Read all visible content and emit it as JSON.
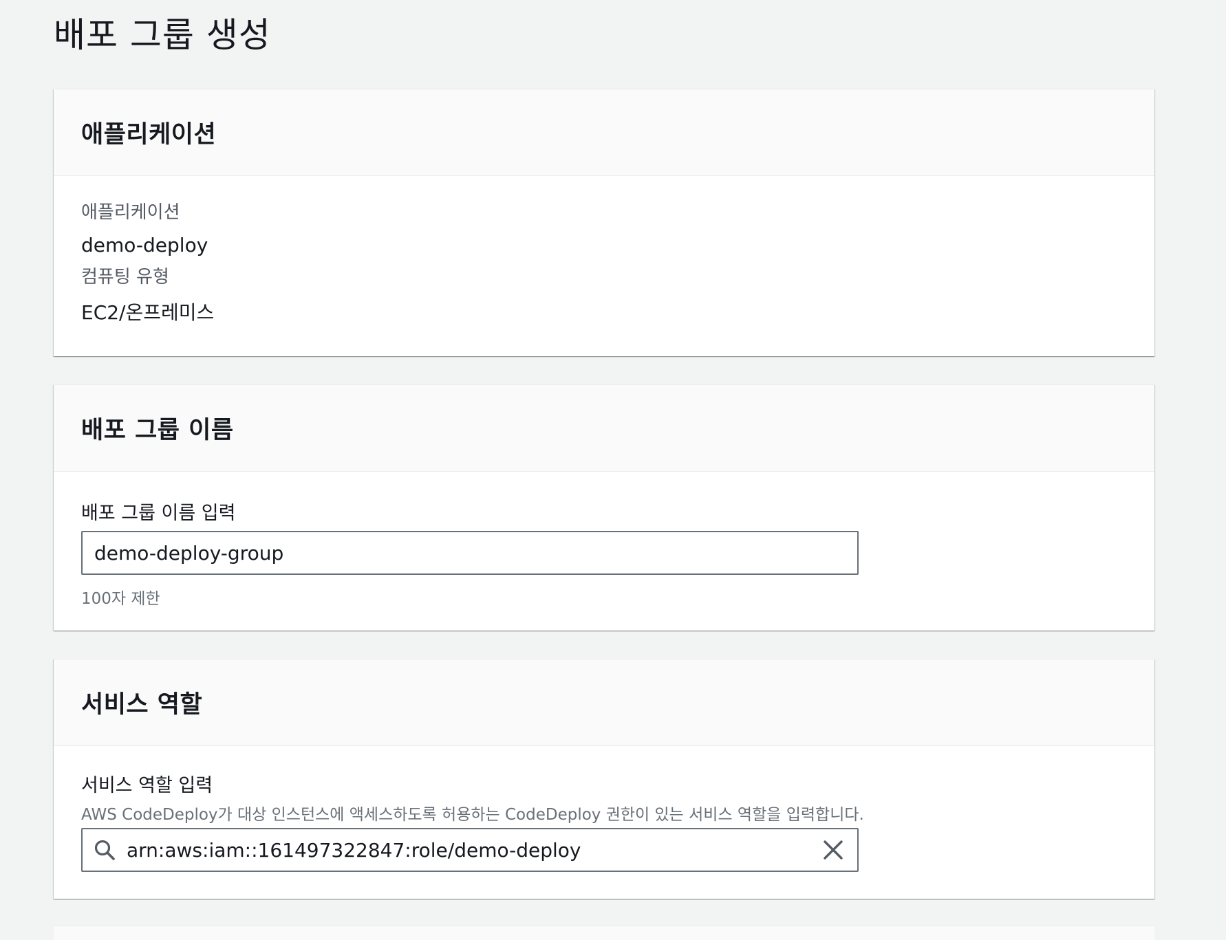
{
  "page": {
    "title": "배포 그룹 생성"
  },
  "application_panel": {
    "header": "애플리케이션",
    "app_label": "애플리케이션",
    "app_value": "demo-deploy",
    "compute_label": "컴퓨팅 유형",
    "compute_value": "EC2/온프레미스"
  },
  "group_name_panel": {
    "header": "배포 그룹 이름",
    "field_label": "배포 그룹 이름 입력",
    "input_value": "demo-deploy-group",
    "hint": "100자 제한"
  },
  "service_role_panel": {
    "header": "서비스 역할",
    "field_label": "서비스 역할 입력",
    "description": "AWS CodeDeploy가 대상 인스턴스에 액세스하도록 허용하는 CodeDeploy 권한이 있는 서비스 역할을 입력합니다.",
    "input_value": "arn:aws:iam::161497322847:role/demo-deploy",
    "search_icon": "search-icon",
    "clear_icon": "close-icon"
  },
  "colors": {
    "background": "#f2f3f3",
    "panel_header": "#fafafa",
    "text_primary": "#16191f",
    "text_secondary": "#545b64",
    "input_border": "#687078"
  }
}
